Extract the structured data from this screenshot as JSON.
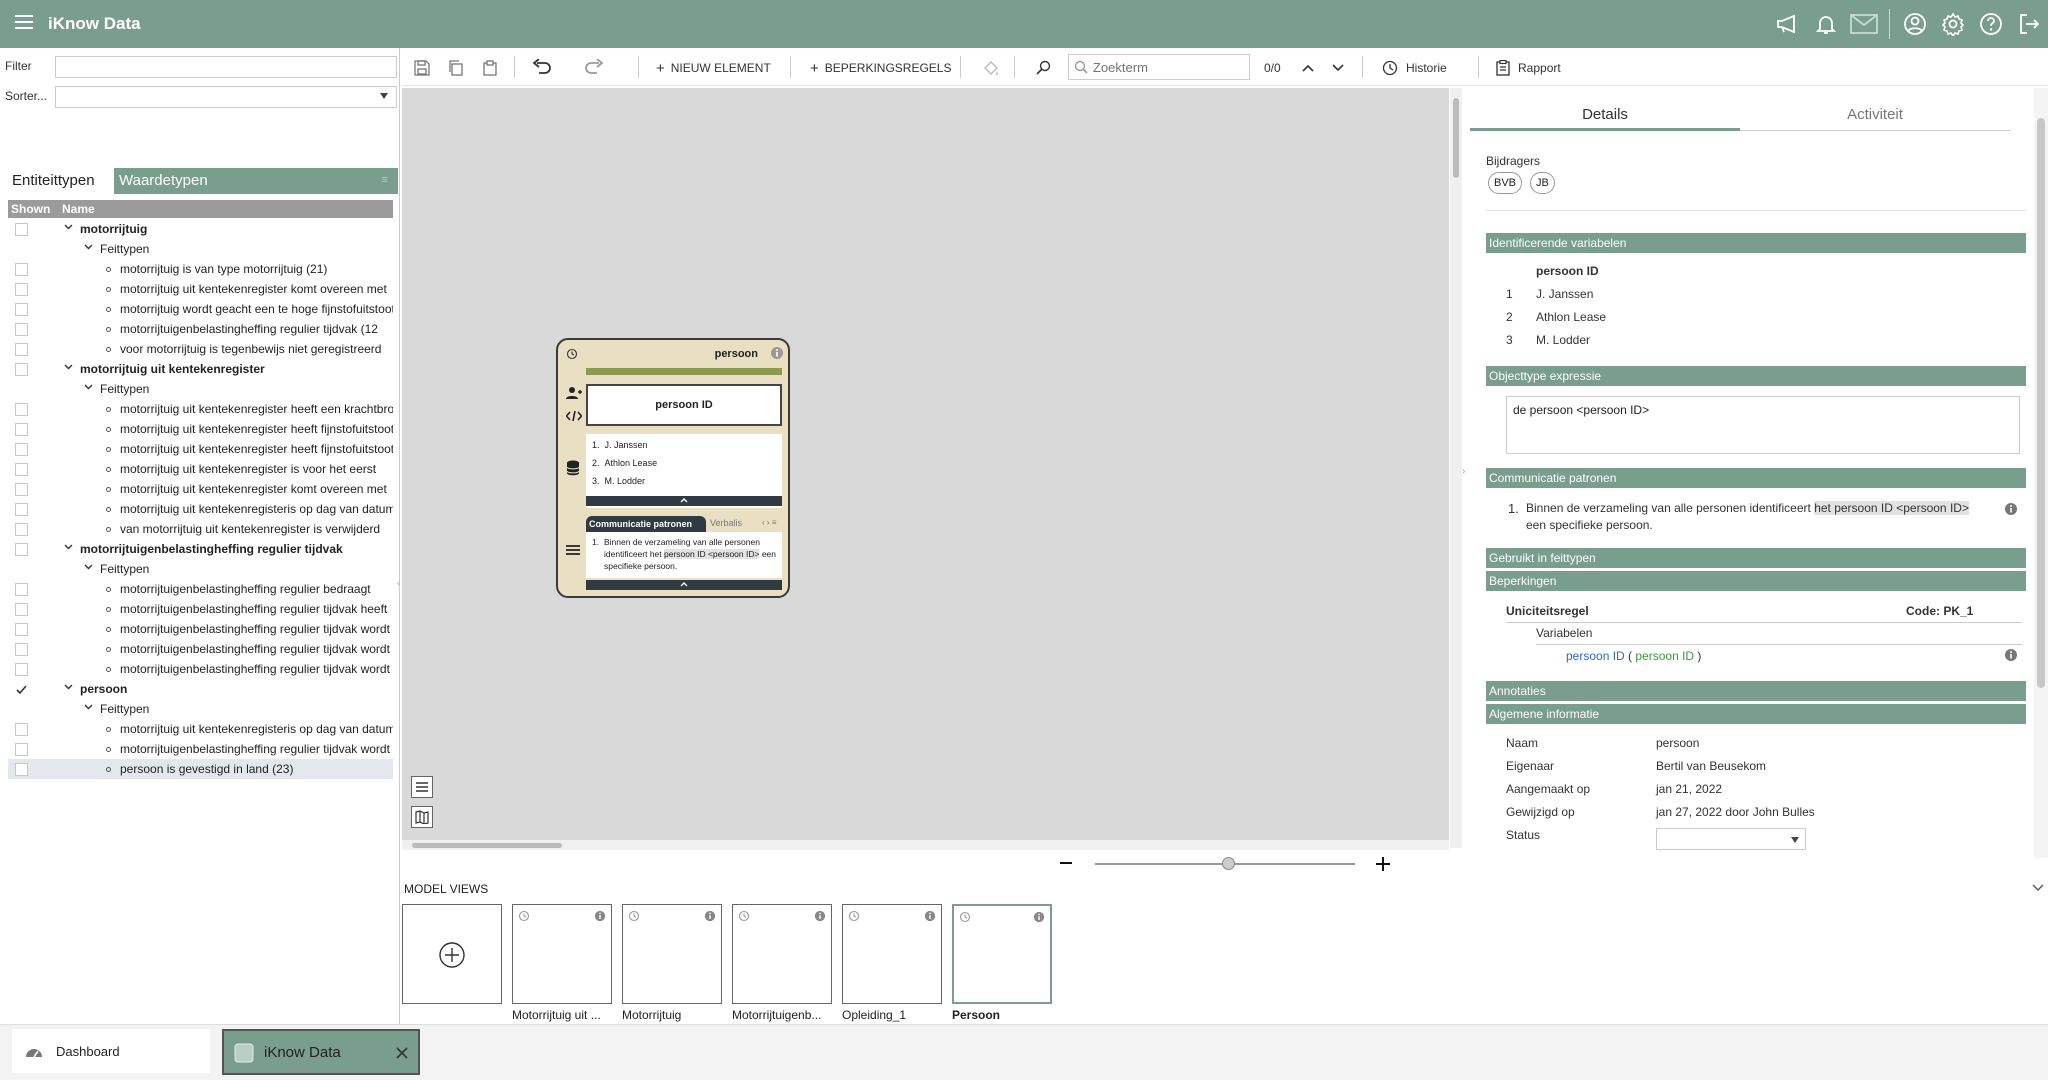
{
  "app": {
    "title": "iKnow Data"
  },
  "left": {
    "filter_label": "Filter",
    "sort_label": "Sorter...",
    "tabs": [
      "Entiteittypen",
      "Waardetypen"
    ],
    "tree_headers": [
      "Shown",
      "Name"
    ],
    "tree": [
      {
        "level": 0,
        "text": "motorrijtuig",
        "checked": false
      },
      {
        "level": 1,
        "text": "Feittypen"
      },
      {
        "level": 2,
        "text": "motorrijtuig is van type motorrijtuig (21)",
        "checked": false
      },
      {
        "level": 2,
        "text": "motorrijtuig uit kentekenregister komt overeen met",
        "checked": false
      },
      {
        "level": 2,
        "text": "motorrijtuig wordt geacht een te hoge fijnstofuitstoot",
        "checked": false
      },
      {
        "level": 2,
        "text": "motorrijtuigenbelastingheffing regulier tijdvak (12",
        "checked": false
      },
      {
        "level": 2,
        "text": "voor motorrijtuig is tegenbewijs niet geregistreerd",
        "checked": false
      },
      {
        "level": 0,
        "text": "motorrijtuig uit kentekenregister",
        "checked": false
      },
      {
        "level": 1,
        "text": "Feittypen"
      },
      {
        "level": 2,
        "text": "motorrijtuig uit kentekenregister heeft een krachtbron",
        "checked": false
      },
      {
        "level": 2,
        "text": "motorrijtuig uit kentekenregister heeft fijnstofuitstoot",
        "checked": false
      },
      {
        "level": 2,
        "text": "motorrijtuig uit kentekenregister heeft fijnstofuitstoot",
        "checked": false
      },
      {
        "level": 2,
        "text": "motorrijtuig uit kentekenregister is voor het eerst",
        "checked": false
      },
      {
        "level": 2,
        "text": "motorrijtuig uit kentekenregister komt overeen met",
        "checked": false
      },
      {
        "level": 2,
        "text": "motorrijtuig uit kentekenregisteris op dag van datum",
        "checked": false
      },
      {
        "level": 2,
        "text": "van motorrijtuig uit kentekenregister is verwijderd",
        "checked": false
      },
      {
        "level": 0,
        "text": "motorrijtuigenbelastingheffing regulier tijdvak",
        "checked": false
      },
      {
        "level": 1,
        "text": "Feittypen"
      },
      {
        "level": 2,
        "text": "motorrijtuigenbelastingheffing regulier bedraagt",
        "checked": false
      },
      {
        "level": 2,
        "text": "motorrijtuigenbelastingheffing regulier tijdvak heeft",
        "checked": false
      },
      {
        "level": 2,
        "text": "motorrijtuigenbelastingheffing regulier tijdvak wordt",
        "checked": false
      },
      {
        "level": 2,
        "text": "motorrijtuigenbelastingheffing regulier tijdvak wordt",
        "checked": false
      },
      {
        "level": 2,
        "text": "motorrijtuigenbelastingheffing regulier tijdvak wordt",
        "checked": false
      },
      {
        "level": 0,
        "text": "persoon",
        "checked": true
      },
      {
        "level": 1,
        "text": "Feittypen"
      },
      {
        "level": 2,
        "text": "motorrijtuig uit kentekenregisteris op dag van datum",
        "checked": false
      },
      {
        "level": 2,
        "text": "motorrijtuigenbelastingheffing regulier tijdvak wordt",
        "checked": false
      },
      {
        "level": 2,
        "text": "persoon is gevestigd in land (23)",
        "checked": false,
        "selected": true
      }
    ]
  },
  "toolbar": {
    "new_element": "NIEUW ELEMENT",
    "constraints": "BEPERKINGSREGELS",
    "search_placeholder": "Zoekterm",
    "search_count": "0/0",
    "history": "Historie",
    "report": "Rapport"
  },
  "card": {
    "title": "persoon",
    "id_label": "persoon ID",
    "values": [
      "J. Janssen",
      "Athlon Lease",
      "M. Lodder"
    ],
    "tab_active": "Communicatie patronen",
    "tab_other": "Verbalis",
    "comm_num": "1.",
    "comm_pre": "Binnen de verzameling van alle personen identificeert het ",
    "comm_hl": "persoon ID <persoon ID>",
    "comm_post": " een specifieke persoon."
  },
  "details": {
    "tab_details": "Details",
    "tab_activity": "Activiteit",
    "contributors_label": "Bijdragers",
    "contributors": [
      "BVB",
      "JB"
    ],
    "sec_identifying": "Identificerende variabelen",
    "id_col": "persoon ID",
    "id_rows": [
      {
        "n": "1",
        "v": "J. Janssen"
      },
      {
        "n": "2",
        "v": "Athlon Lease"
      },
      {
        "n": "3",
        "v": "M. Lodder"
      }
    ],
    "sec_expression": "Objecttype expressie",
    "expression": "de persoon <persoon ID>",
    "sec_patterns": "Communicatie patronen",
    "pattern_num": "1.",
    "pattern_pre": "Binnen de verzameling van alle personen identificeert ",
    "pattern_hl": "het persoon ID <persoon ID>",
    "pattern_post": " een specifieke persoon.",
    "sec_used": "Gebruikt in feittypen",
    "sec_constraints": "Beperkingen",
    "unique_rule": "Uniciteitsregel",
    "code": "Code: PK_1",
    "variables_label": "Variabelen",
    "var_blue": "persoon ID",
    "var_open": " ( ",
    "var_green": "persoon ID",
    "var_close": " )",
    "sec_annotations": "Annotaties",
    "sec_general": "Algemene informatie",
    "general": [
      {
        "k": "Naam",
        "v": "persoon"
      },
      {
        "k": "Eigenaar",
        "v": "Bertil van Beusekom"
      },
      {
        "k": "Aangemaakt op",
        "v": "jan 21, 2022"
      },
      {
        "k": "Gewijzigd op",
        "v": "jan 27, 2022 door John Bulles"
      },
      {
        "k": "Status",
        "v": ""
      }
    ]
  },
  "model_views": {
    "label": "MODEL VIEWS",
    "items": [
      "Motorrijtuig uit ...",
      "Motorrijtuig",
      "Motorrijtuigenb...",
      "Opleiding_1",
      "Persoon"
    ]
  },
  "bottom": {
    "dashboard": "Dashboard",
    "tab": "iKnow Data"
  },
  "colors": {
    "accent": "#7a9e8e",
    "card": "#e9dfc2",
    "dark": "#2f3a43"
  }
}
